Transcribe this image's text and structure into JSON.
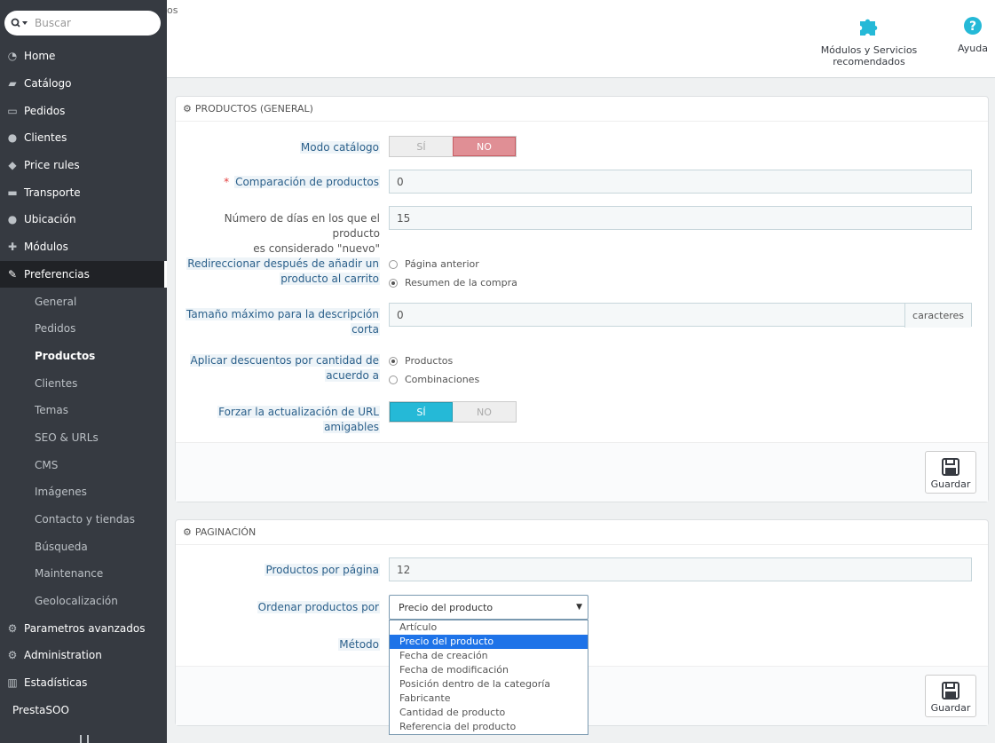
{
  "search": {
    "placeholder": "Buscar"
  },
  "sidebar": {
    "items": [
      {
        "label": "Home",
        "icon": "dashboard-icon"
      },
      {
        "label": "Catálogo",
        "icon": "book-icon"
      },
      {
        "label": "Pedidos",
        "icon": "credit-card-icon"
      },
      {
        "label": "Clientes",
        "icon": "users-icon"
      },
      {
        "label": "Price rules",
        "icon": "tag-icon"
      },
      {
        "label": "Transporte",
        "icon": "truck-icon"
      },
      {
        "label": "Ubicación",
        "icon": "globe-icon"
      },
      {
        "label": "Módulos",
        "icon": "puzzle-icon"
      },
      {
        "label": "Preferencias",
        "icon": "wrench-icon"
      }
    ],
    "subitems": [
      "General",
      "Pedidos",
      "Productos",
      "Clientes",
      "Temas",
      "SEO & URLs",
      "CMS",
      "Imágenes",
      "Contacto y tiendas",
      "Búsqueda",
      "Maintenance",
      "Geolocalización"
    ],
    "more_items": [
      {
        "label": "Parametros avanzados",
        "icon": "gears-icon"
      },
      {
        "label": "Administration",
        "icon": "gear-icon"
      },
      {
        "label": "Estadísticas",
        "icon": "bar-chart-icon"
      }
    ],
    "footer_item": "PrestaSOO"
  },
  "header": {
    "crumb_fragment": "os",
    "modules_label": "Módulos y Servicios recomendados",
    "help_label": "Ayuda",
    "accent": "#25b9d7"
  },
  "panel_general": {
    "title": "PRODUCTOS (GENERAL)",
    "catalog_mode_label": "Modo catálogo",
    "catalog_yes": "SÍ",
    "catalog_no": "NO",
    "compare_label": "Comparación de productos",
    "compare_value": "0",
    "new_days_label_1": "Número de días en los que el producto",
    "new_days_label_2": "es considerado \"nuevo\"",
    "new_days_value": "15",
    "redirect_label_1": "Redireccionar después de añadir un",
    "redirect_label_2": "producto al carrito",
    "redirect_opt1": "Página anterior",
    "redirect_opt2": "Resumen de la compra",
    "short_desc_label_1": "Tamaño máximo para la descripción",
    "short_desc_label_2": "corta",
    "short_desc_value": "0",
    "short_desc_addon": "caracteres",
    "discount_label_1": "Aplicar descuentos por cantidad de",
    "discount_label_2": "acuerdo a",
    "discount_opt1": "Productos",
    "discount_opt2": "Combinaciones",
    "friendly_label_1": "Forzar la actualización de URL",
    "friendly_label_2": "amigables",
    "friendly_yes": "SÍ",
    "friendly_no": "NO",
    "save_label": "Guardar"
  },
  "panel_pagination": {
    "title": "PAGINACIÓN",
    "per_page_label": "Productos por página",
    "per_page_value": "12",
    "order_label": "Ordenar productos por",
    "order_selected": "Precio del producto",
    "method_label": "Método",
    "save_label": "Guardar",
    "order_options": [
      "Artículo",
      "Precio del producto",
      "Fecha de creación",
      "Fecha de modificación",
      "Posición dentro de la categoría",
      "Fabricante",
      "Cantidad de producto",
      "Referencia del producto"
    ]
  }
}
